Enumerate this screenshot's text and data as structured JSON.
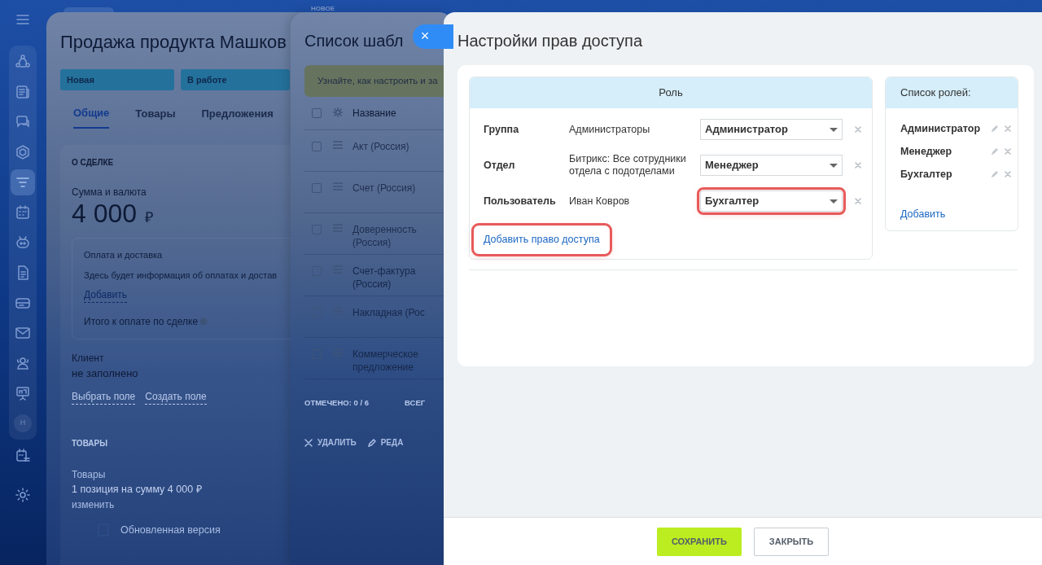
{
  "sidebar": {
    "items": [
      {
        "kind": "icon",
        "selected": false
      },
      {
        "kind": "icon",
        "selected": false
      },
      {
        "kind": "icon",
        "selected": false
      },
      {
        "kind": "icon",
        "selected": false
      },
      {
        "kind": "icon",
        "selected": true
      },
      {
        "kind": "icon",
        "selected": false
      },
      {
        "kind": "icon",
        "selected": false
      },
      {
        "kind": "icon",
        "selected": false
      },
      {
        "kind": "icon",
        "selected": false
      },
      {
        "kind": "icon",
        "selected": false
      },
      {
        "kind": "icon",
        "selected": false
      },
      {
        "kind": "icon",
        "selected": false
      },
      {
        "kind": "avatar",
        "label": "Н",
        "selected": false
      },
      {
        "kind": "icon",
        "selected": false
      },
      {
        "kind": "icon",
        "selected": false
      }
    ]
  },
  "deal": {
    "title": "Продажа продукта Машков",
    "stages": [
      {
        "label": "Новая"
      },
      {
        "label": "В работе"
      }
    ],
    "tabs": [
      {
        "label": "Общие",
        "selected": true
      },
      {
        "label": "Товары",
        "selected": false
      },
      {
        "label": "Предложения",
        "selected": false
      }
    ],
    "section_title": "О СДЕЛКЕ",
    "amount_label": "Сумма и валюта",
    "amount": "4 000",
    "currency": "₽",
    "payment": {
      "title": "Оплата и доставка",
      "text": "Здесь будет информация об оплатах и достав",
      "link": "Добавить",
      "total": "Итого к оплате по сделке"
    },
    "client_label": "Клиент",
    "client_value": "не заполнено",
    "client_links": [
      "Выбрать поле",
      "Создать поле"
    ],
    "products_title": "ТОВАРЫ",
    "products_label": "Товары",
    "products_value": "1 позиция на сумму 4 000 ₽",
    "products_link": "изменить",
    "update_text": "Обновленная версия"
  },
  "templates": {
    "badge": "НОВОЕ",
    "title": "Список шабл",
    "info": "Узнайте, как настроить и за",
    "header": {
      "checked": false,
      "label": "Название"
    },
    "rows": [
      {
        "name": "Акт (Россия)",
        "checked": false
      },
      {
        "name": "Счет (Россия)",
        "checked": false
      },
      {
        "name": "Доверенность (Россия)",
        "checked": false
      },
      {
        "name": "Счет-фактура (Россия)",
        "checked": false
      },
      {
        "name": "Накладная (Рос",
        "checked": false
      },
      {
        "name": "Коммерческое предложение",
        "checked": false
      }
    ],
    "selected_count": "ОТМЕЧЕНО: **0 / 6**",
    "total": "ВСЕГ",
    "actions": [
      "УДАЛИТЬ",
      "РЕДА"
    ]
  },
  "close_button": "×",
  "access": {
    "title": "Настройки прав доступа",
    "column": "Роль",
    "rows": [
      {
        "type": "Группа",
        "name": "Администраторы",
        "role": "Администратор",
        "highlighted": false
      },
      {
        "type": "Отдел",
        "name": "Битрикс: Все сотрудники отдела с подотделами",
        "role": "Менеджер",
        "highlighted": false
      },
      {
        "type": "Пользователь",
        "name": "Иван Ковров",
        "role": "Бухгалтер",
        "highlighted": true
      }
    ],
    "add_link": {
      "label": "Добавить право доступа",
      "highlighted": true
    },
    "roles": {
      "title": "Список ролей:",
      "items": [
        "Администратор",
        "Менеджер",
        "Бухгалтер"
      ],
      "add": "Добавить"
    }
  },
  "buttons": [
    "СОХРАНИТЬ",
    "ЗАКРЫТЬ"
  ]
}
